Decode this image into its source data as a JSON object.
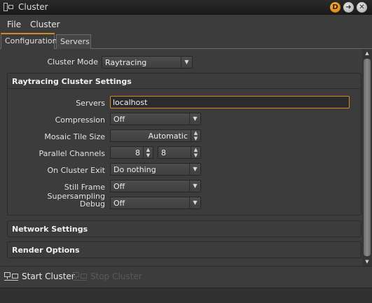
{
  "window": {
    "title": "Cluster"
  },
  "titlebar_buttons": {
    "d_label": "D",
    "arrow_label": "➜",
    "close_label": "✕"
  },
  "menu": {
    "items": [
      "File",
      "Cluster"
    ]
  },
  "tabs": [
    {
      "label": "Configuration",
      "active": true
    },
    {
      "label": "Servers",
      "active": false
    }
  ],
  "cluster_mode": {
    "label": "Cluster Mode",
    "value": "Raytracing"
  },
  "raytracing": {
    "header": "Raytracing Cluster Settings",
    "servers": {
      "label": "Servers",
      "value": "localhost"
    },
    "compression": {
      "label": "Compression",
      "value": "Off"
    },
    "mosaic_tile_size": {
      "label": "Mosaic Tile Size",
      "value": "Automatic"
    },
    "parallel_channels": {
      "label": "Parallel Channels",
      "value_a": "8",
      "value_b": "8"
    },
    "on_cluster_exit": {
      "label": "On Cluster Exit",
      "value": "Do nothing"
    },
    "still_frame_supersampling": {
      "label": "Still Frame Supersampling",
      "value": "Off"
    },
    "debug": {
      "label": "Debug",
      "value": "Off"
    }
  },
  "network_settings": {
    "header": "Network Settings"
  },
  "render_options": {
    "header": "Render Options"
  },
  "statusbar": {
    "start_label": "Start Cluster",
    "stop_label": "Stop Cluster"
  },
  "colors": {
    "accent": "#d98a1c",
    "background": "#3c3c3c",
    "titlebar": "#1f1f1f",
    "d_badge": "#e8900f"
  }
}
